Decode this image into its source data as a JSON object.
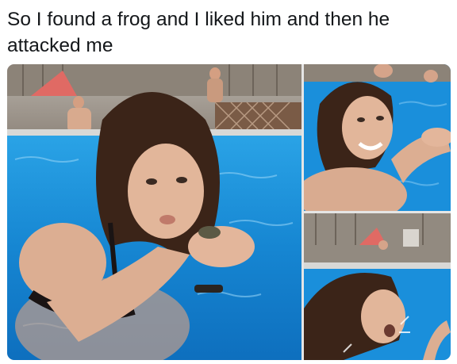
{
  "post": {
    "caption": "So I found a frog and I liked him and then he attacked me"
  },
  "photos": [
    {
      "id": "main"
    },
    {
      "id": "top-right"
    },
    {
      "id": "bottom-right"
    }
  ],
  "colors": {
    "pool_water": "#1b8fd6",
    "pool_deep": "#0d6fbf",
    "skin": "#e2b69a",
    "hair": "#3b2418",
    "fence": "#8a7f74",
    "text": "#14171a"
  }
}
